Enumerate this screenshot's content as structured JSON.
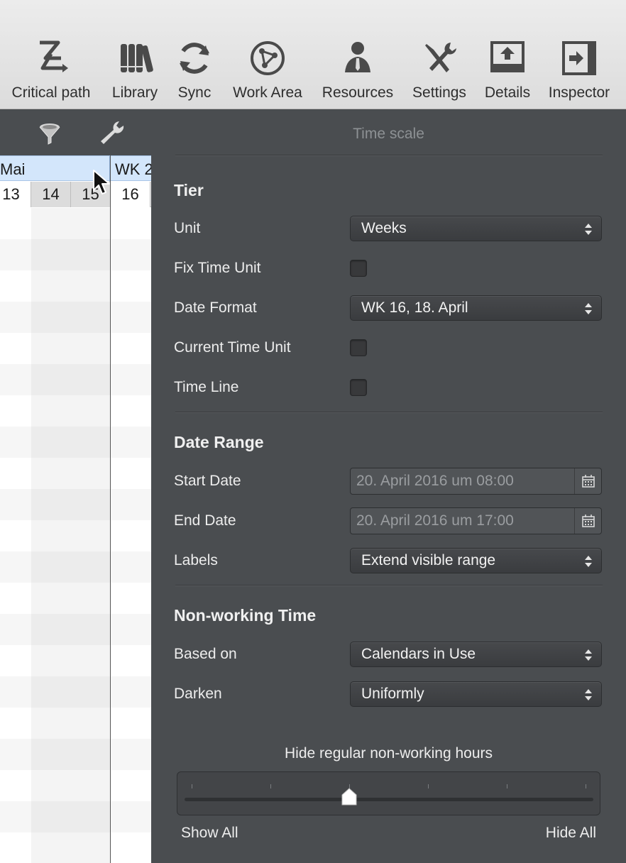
{
  "toolbar": {
    "items": [
      {
        "label": "Critical path",
        "icon": "critical-path-icon"
      },
      {
        "label": "Library",
        "icon": "library-icon"
      },
      {
        "label": "Sync",
        "icon": "sync-icon"
      },
      {
        "label": "Work Area",
        "icon": "work-area-icon"
      },
      {
        "label": "Resources",
        "icon": "resources-icon"
      },
      {
        "label": "Settings",
        "icon": "settings-icon"
      },
      {
        "label": "Details",
        "icon": "details-icon"
      },
      {
        "label": "Inspector",
        "icon": "inspector-icon"
      }
    ]
  },
  "gantt": {
    "month_left": "Mai",
    "month_right": "WK 2",
    "days": [
      "13",
      "14",
      "15",
      "16"
    ]
  },
  "panel": {
    "title": "Time scale",
    "tier": {
      "title": "Tier",
      "unit_label": "Unit",
      "unit_value": "Weeks",
      "fix_time_unit_label": "Fix Time Unit",
      "fix_time_unit_checked": false,
      "date_format_label": "Date Format",
      "date_format_value": "WK 16, 18. April",
      "current_time_unit_label": "Current Time Unit",
      "current_time_unit_checked": false,
      "time_line_label": "Time Line",
      "time_line_checked": false
    },
    "date_range": {
      "title": "Date Range",
      "start_label": "Start Date",
      "start_value": "20. April 2016 um 08:00",
      "end_label": "End Date",
      "end_value": "20. April 2016 um 17:00",
      "labels_label": "Labels",
      "labels_value": "Extend visible range"
    },
    "non_working": {
      "title": "Non-working Time",
      "based_on_label": "Based on",
      "based_on_value": "Calendars in Use",
      "darken_label": "Darken",
      "darken_value": "Uniformly"
    },
    "slider": {
      "caption": "Hide regular non-working hours",
      "min_label": "Show All",
      "max_label": "Hide All",
      "ticks": 6,
      "value_fraction": 0.4
    }
  },
  "colors": {
    "toolbar_bg": "#e4e4e4",
    "panel_bg": "#4a4d50",
    "month_header_bg": "#d3e6fb"
  }
}
